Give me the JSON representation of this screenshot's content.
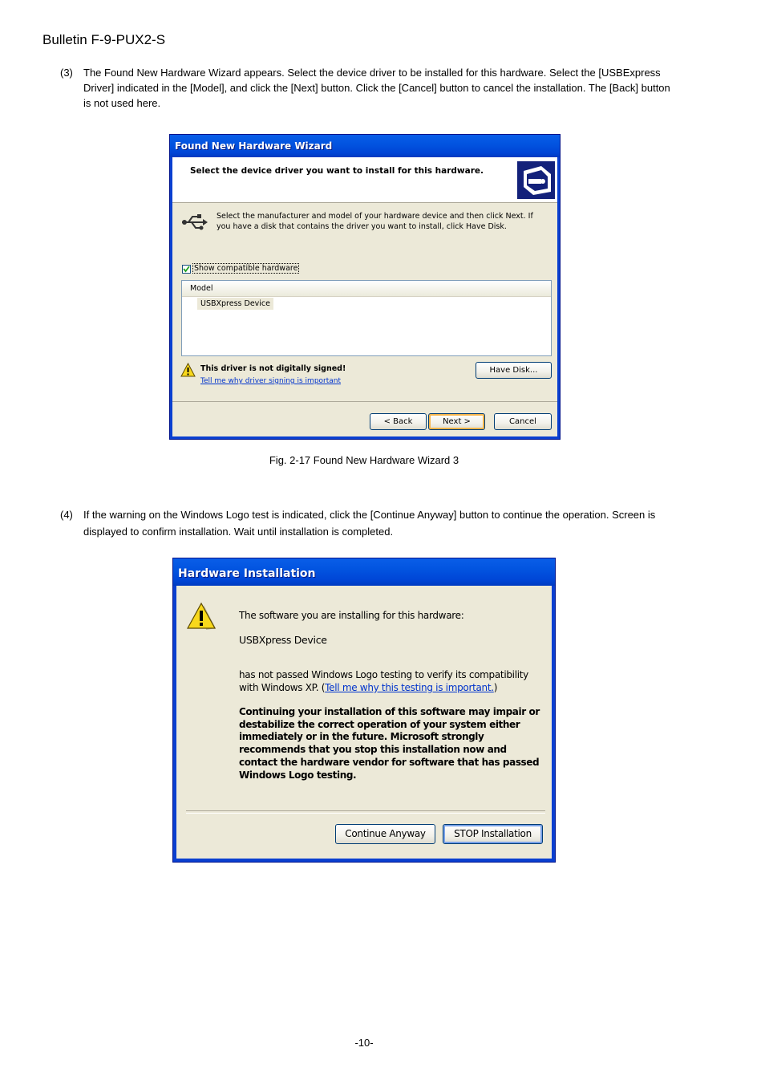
{
  "header": {
    "bulletin": "Bulletin F-9-PUX2-S"
  },
  "step3": {
    "num": "(3)",
    "text": "The Found New Hardware Wizard appears. Select the device driver to be installed for this hardware. Select the [USBExpress Driver] indicated in the [Model], and click the [Next] button. Click the [Cancel] button to cancel the installation. The [Back] button is not used here."
  },
  "wizard": {
    "title": "Found New Hardware Wizard",
    "heading": "Select the device driver you want to install for this hardware.",
    "description": "Select the manufacturer and model of your hardware device and then click Next. If you have a disk that contains the driver you want to install, click Have Disk.",
    "checkbox_label": "Show compatible hardware",
    "checkbox_checked": true,
    "list_header": "Model",
    "list_items": [
      "USBXpress Device"
    ],
    "warning_text": "This driver is not digitally signed!",
    "warning_link": "Tell me why driver signing is important",
    "have_disk": "Have Disk...",
    "back": "< Back",
    "next": "Next >",
    "cancel": "Cancel",
    "icons": {
      "header": "hardware-install-icon",
      "usb": "usb-icon",
      "warning": "warning-icon"
    }
  },
  "caption1": "Fig. 2-17 Found New Hardware Wizard 3",
  "step4": {
    "num": "(4)",
    "text": "If the warning on the Windows Logo test is indicated, click the [Continue Anyway] button to continue the operation. Screen is displayed to confirm installation. Wait until installation is completed."
  },
  "hwinstall": {
    "title": "Hardware Installation",
    "line1": "The software you are installing for this hardware:",
    "device": "USBXpress Device",
    "line2a": "has not passed Windows Logo testing to verify its compatibility",
    "line2b_pre": "with Windows XP. (",
    "line2b_link": "Tell me why this testing is important.",
    "line2b_post": ")",
    "bold": "Continuing your installation of this software may impair or destabilize the correct operation of your system either immediately or in the future. Microsoft strongly recommends that you stop this installation now and contact the hardware vendor for software that has passed Windows Logo testing.",
    "continue": "Continue Anyway",
    "stop": "STOP Installation"
  },
  "footer": {
    "page": "-10-"
  }
}
